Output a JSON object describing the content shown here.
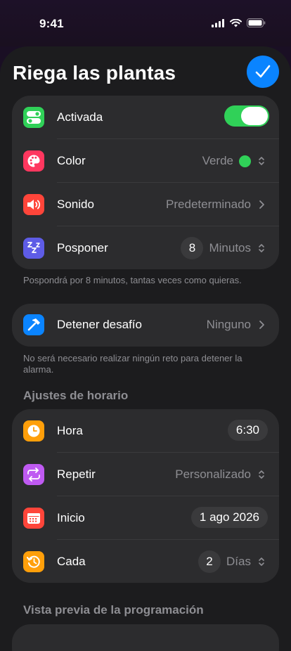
{
  "status": {
    "time": "9:41"
  },
  "header": {
    "title": "Riega las plantas"
  },
  "main_card": {
    "activada_label": "Activada",
    "activada_on": true,
    "color_label": "Color",
    "color_value": "Verde",
    "color_hex": "#30d158",
    "sonido_label": "Sonido",
    "sonido_value": "Predeterminado",
    "posponer_label": "Posponer",
    "posponer_number": "8",
    "posponer_unit": "Minutos"
  },
  "posponer_footer": "Pospondrá por 8 minutos, tantas veces como quieras.",
  "desafio_card": {
    "label": "Detener desafío",
    "value": "Ninguno"
  },
  "desafio_footer": "No será necesario realizar ningún reto para detener la alarma.",
  "horario_section": {
    "header": "Ajustes de horario",
    "hora_label": "Hora",
    "hora_value": "6:30",
    "repetir_label": "Repetir",
    "repetir_value": "Personalizado",
    "inicio_label": "Inicio",
    "inicio_value": "1 ago 2026",
    "cada_label": "Cada",
    "cada_number": "2",
    "cada_unit": "Días"
  },
  "preview_section": {
    "header": "Vista previa de la programación"
  }
}
